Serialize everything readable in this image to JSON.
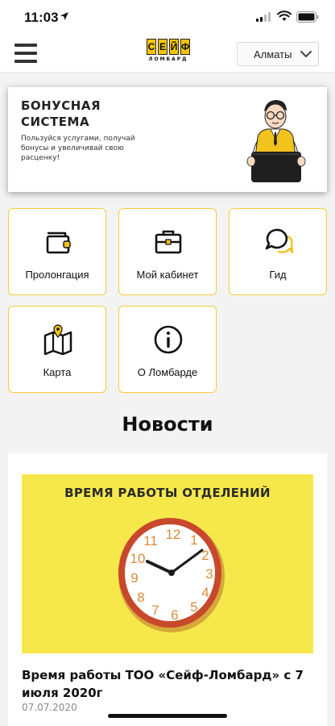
{
  "status_bar": {
    "time": "11:03"
  },
  "header": {
    "logo": {
      "letters": [
        "С",
        "Е",
        "Й",
        "Ф"
      ],
      "subtitle": "ЛОМБАРД"
    },
    "city": "Алматы"
  },
  "banner": {
    "title": "БОНУСНАЯ СИСТЕМА",
    "text": "Пользуйся услугами, получай бонусы и увеличивай свою расценку!"
  },
  "tiles": [
    {
      "label": "Пролонгация",
      "icon": "wallet-icon"
    },
    {
      "label": "Мой кабинет",
      "icon": "briefcase-icon"
    },
    {
      "label": "Гид",
      "icon": "chat-icon"
    },
    {
      "label": "Карта",
      "icon": "map-icon"
    },
    {
      "label": "О Ломбарде",
      "icon": "info-icon"
    }
  ],
  "news": {
    "heading": "Новости",
    "items": [
      {
        "image_caption": "ВРЕМЯ РАБОТЫ ОТДЕЛЕНИЙ",
        "title": "Время работы ТОО «Сейф-Ломбард» с 7 июля 2020г",
        "date": "07.07.2020"
      }
    ]
  },
  "colors": {
    "accent": "#f2cd3c",
    "banner_image_bg": "#f6e84a",
    "clock_rim": "#c8482c"
  }
}
